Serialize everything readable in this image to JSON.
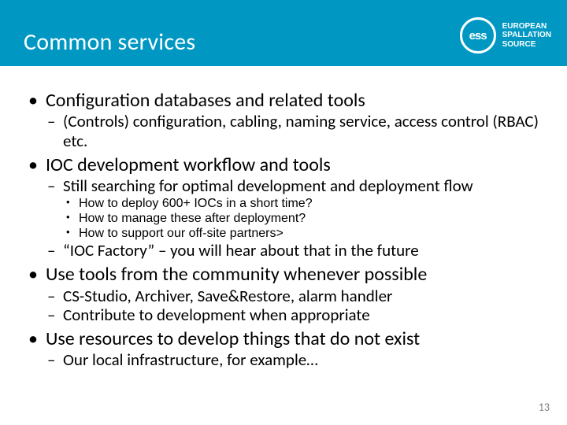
{
  "header": {
    "title": "Common services",
    "logo_text_line1": "EUROPEAN",
    "logo_text_line2": "SPALLATION",
    "logo_text_line3": "SOURCE",
    "logo_abbrev": "ess"
  },
  "content": {
    "b1": {
      "text": "Configuration databases and related tools",
      "s1": "(Controls) configuration, cabling, naming service, access control (RBAC) etc."
    },
    "b2": {
      "text": "IOC development workflow and tools",
      "s1": "Still searching for optimal development and deployment flow",
      "s1_a": "How to deploy 600+ IOCs in a short time?",
      "s1_b": "How to manage these after deployment?",
      "s1_c": "How to support our off-site partners>",
      "s2": "“IOC Factory” – you will hear about that in the future"
    },
    "b3": {
      "text": "Use tools from the community whenever possible",
      "s1": "CS-Studio, Archiver, Save&Restore, alarm handler",
      "s2": "Contribute to development when appropriate"
    },
    "b4": {
      "text": "Use resources to develop things that do not exist",
      "s1": "Our local infrastructure, for example…"
    }
  },
  "page_number": "13"
}
